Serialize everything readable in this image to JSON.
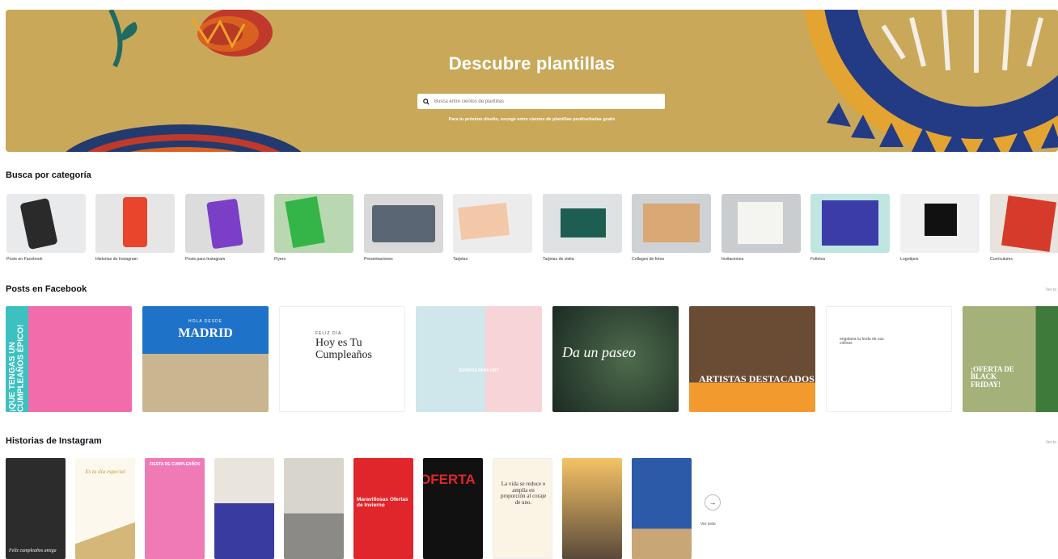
{
  "hero": {
    "title": "Descubre plantillas",
    "search_placeholder": "Busca entre cientos de plantillas",
    "subtitle": "Para tu próximo diseño, escoge entre cientos de plantillas prediseñadas gratis",
    "background_color": "#c9a85a"
  },
  "categories": {
    "title": "Busca por categoría",
    "items": [
      {
        "label": "Posts en Facebook",
        "color": "#e9eaec"
      },
      {
        "label": "Historias de Instagram",
        "color": "#e6e6e6"
      },
      {
        "label": "Posts para Instagram",
        "color": "#dcdcdc"
      },
      {
        "label": "Flyers",
        "color": "#b9d8b1"
      },
      {
        "label": "Presentaciones",
        "color": "#d9d9d9"
      },
      {
        "label": "Tarjetas",
        "color": "#ececec"
      },
      {
        "label": "Tarjetas de visita",
        "color": "#dfe2e2"
      },
      {
        "label": "Collages de fotos",
        "color": "#cfd2d4"
      },
      {
        "label": "Invitaciones",
        "color": "#c9cdd0"
      },
      {
        "label": "Folletos",
        "color": "#bfe6e0"
      },
      {
        "label": "Logotipos",
        "color": "#f0f0f0"
      },
      {
        "label": "Currículums",
        "color": "#e8e3dc"
      }
    ]
  },
  "facebook": {
    "title": "Posts en Facebook",
    "see_all": "Ver to",
    "cards": [
      {
        "text": "¡QUE TENGAS UN CUMPLEAÑOS ÉPICO!",
        "bg": "#3dc0c0"
      },
      {
        "text": "MADRID",
        "kicker": "HOLA DESDE",
        "bg": "#1e73c8"
      },
      {
        "text": "Hoy es Tu Cumpleaños",
        "kicker": "FELIZ DÍA",
        "bg": "#ffffff"
      },
      {
        "text": "SONRISA PARA HOY",
        "bg": "#f6d4d8"
      },
      {
        "text": "Da un paseo",
        "bg": "#2d3f33"
      },
      {
        "text": "ARTISTAS DESTACADOS",
        "bg": "#6a4b33"
      },
      {
        "text": "engalana tu boda de sus colinas",
        "bg": "#ffffff"
      },
      {
        "text": "¡OFERTA DE BLACK FRIDAY!",
        "bg": "#a4b27a"
      }
    ]
  },
  "instagram": {
    "title": "Historias de Instagram",
    "see_all": "Ver to",
    "see_all_button": "Ver todo",
    "cards": [
      {
        "text": "Feliz cumpleaños amiga",
        "bg": "#2c2c2c"
      },
      {
        "text": "Es tu día especial",
        "bg": "#fdf8ee"
      },
      {
        "text": "FIESTA DE CUMPLEAÑOS",
        "bg": "#f07ab6"
      },
      {
        "text": "",
        "bg": "#3a3ba0"
      },
      {
        "text": "",
        "bg": "#d8d5cc"
      },
      {
        "text": "Maravillosas Ofertas de Invierno",
        "bg": "#e0262a"
      },
      {
        "text": "OFERTA",
        "bg": "#111111"
      },
      {
        "text": "La vida se reduce o amplía en proporción al coraje de uno.",
        "bg": "#fbf4e4"
      },
      {
        "text": "",
        "bg": "#c89a4f"
      },
      {
        "text": "",
        "bg": "#2c5aa8"
      }
    ]
  }
}
